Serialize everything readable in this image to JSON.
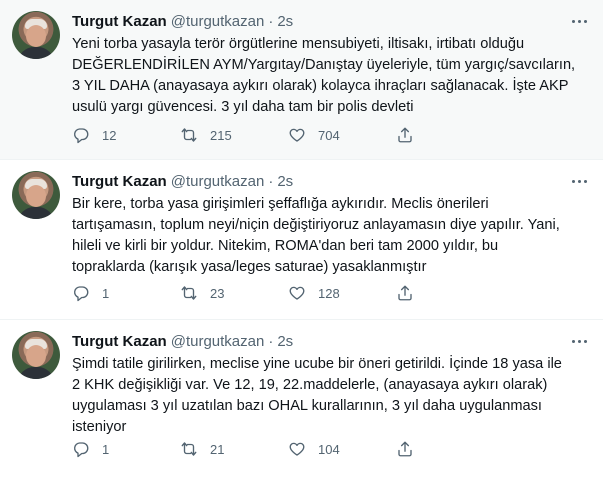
{
  "tweets": [
    {
      "name": "Turgut Kazan",
      "handle": "@turgutkazan",
      "separator": "·",
      "time": "2s",
      "text": "Yeni torba yasayla terör örgütlerine mensubiyeti, iltisakı, irtibatı olduğu\nDEĞERLENDİRİLEN AYM/Yargıtay/Danıştay üyeleriyle, tüm yargıç/savcıların,\n3 YIL DAHA (anayasaya aykırı olarak) kolayca ihraçları sağlanacak. İşte AKP\nusulü yargı güvencesi. 3 yıl daha tam bir polis devleti",
      "replies": "12",
      "retweets": "215",
      "likes": "704"
    },
    {
      "name": "Turgut Kazan",
      "handle": "@turgutkazan",
      "separator": "·",
      "time": "2s",
      "text": "Bir kere, torba yasa girişimleri şeffaflığa aykırıdır. Meclis önerileri\ntartışamasın, toplum neyi/niçin değiştiriyoruz anlayamasın diye yapılır. Yani,\nhileli ve kirli bir yoldur. Nitekim, ROMA'dan beri tam 2000 yıldır, bu\ntopraklarda (karışık yasa/leges saturae) yasaklanmıştır",
      "replies": "1",
      "retweets": "23",
      "likes": "128"
    },
    {
      "name": "Turgut Kazan",
      "handle": "@turgutkazan",
      "separator": "·",
      "time": "2s",
      "text": "Şimdi tatile girilirken, meclise yine ucube bir öneri getirildi. İçinde 18 yasa ile\n2 KHK değişikliği var. Ve 12, 19, 22.maddelerle, (anayasaya aykırı olarak)\nuygulaması 3 yıl uzatılan bazı OHAL kurallarının, 3 yıl daha uygulanması\nisteniyor",
      "replies": "1",
      "retweets": "21",
      "likes": "104"
    }
  ],
  "icons": {
    "reply": "reply-icon",
    "retweet": "retweet-icon",
    "like": "heart-icon",
    "share": "share-icon",
    "more": "more-icon"
  },
  "colors": {
    "text": "#0f1419",
    "secondary": "#536471",
    "highlight_bg": "#f7f9f9",
    "divider": "#eff3f4"
  }
}
